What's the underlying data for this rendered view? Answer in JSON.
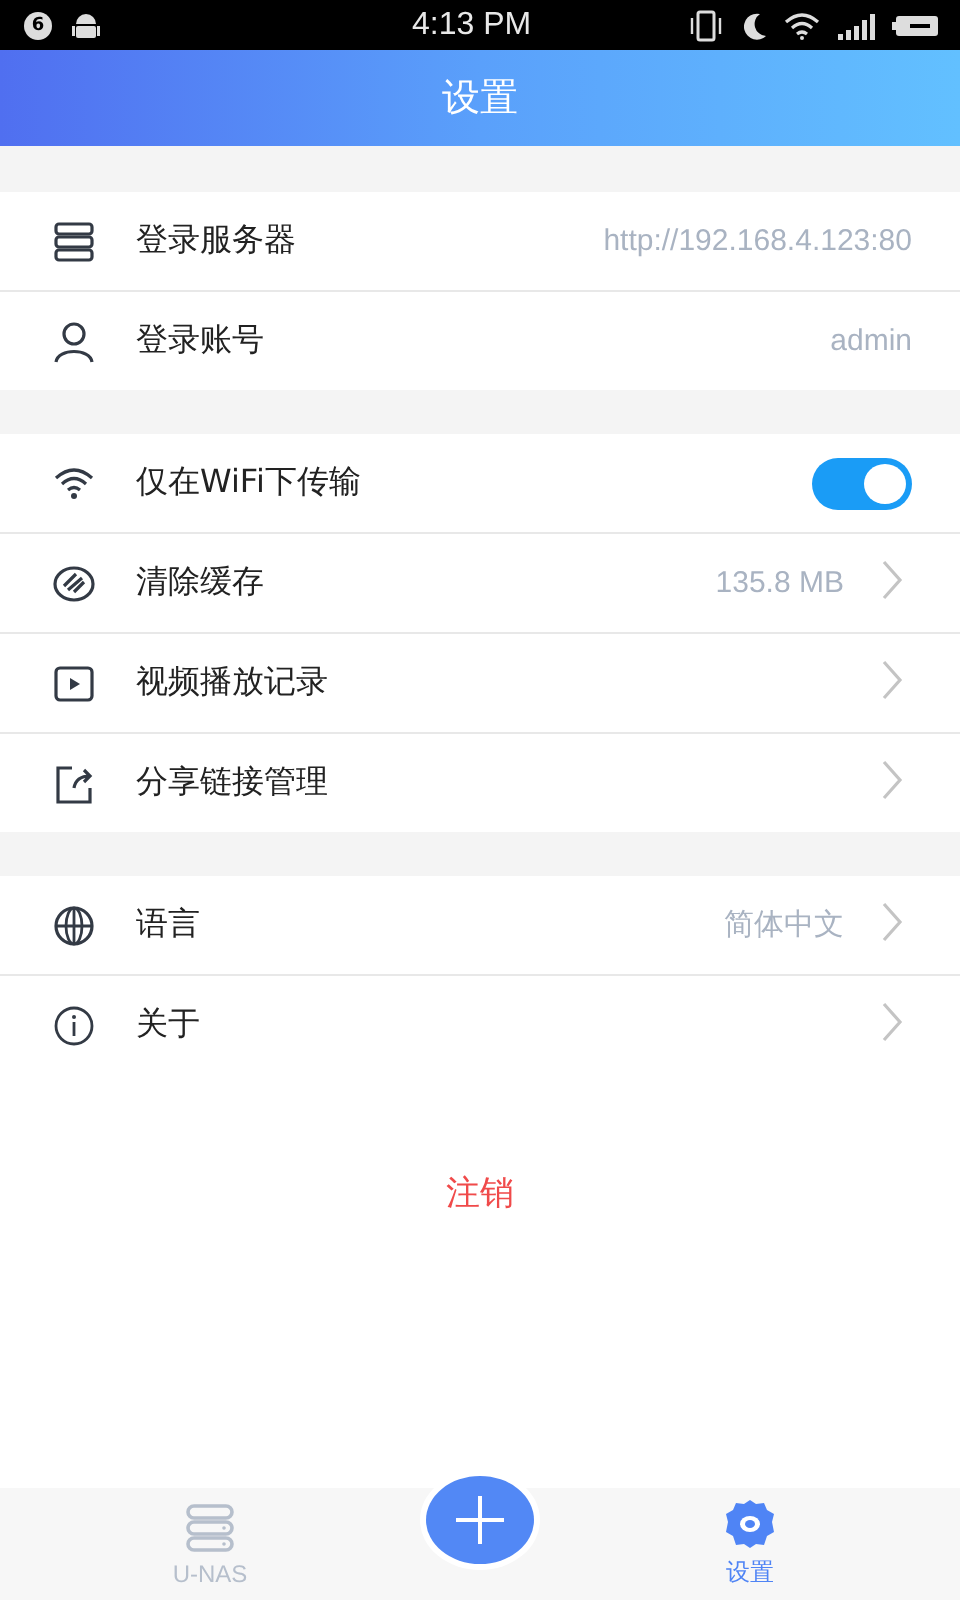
{
  "status_bar": {
    "badge": "6",
    "time": "4:13 PM"
  },
  "header": {
    "title": "设置"
  },
  "sections": [
    {
      "rows": [
        {
          "kind": "info",
          "label": "登录服务器",
          "value": "http://192.168.4.123:80"
        },
        {
          "kind": "info",
          "label": "登录账号",
          "value": "admin"
        }
      ]
    },
    {
      "rows": [
        {
          "kind": "toggle",
          "label": "仅在WiFi下传输",
          "on": true
        },
        {
          "kind": "nav",
          "label": "清除缓存",
          "value": "135.8 MB"
        },
        {
          "kind": "nav",
          "label": "视频播放记录"
        },
        {
          "kind": "nav",
          "label": "分享链接管理"
        }
      ]
    },
    {
      "rows": [
        {
          "kind": "nav",
          "label": "语言",
          "value": "简体中文"
        },
        {
          "kind": "nav",
          "label": "关于"
        }
      ]
    }
  ],
  "logout": {
    "label": "注销"
  },
  "tab_bar": {
    "tabs": [
      {
        "label": "U-NAS",
        "selected": false
      },
      {
        "label": "设置",
        "selected": true
      }
    ]
  }
}
